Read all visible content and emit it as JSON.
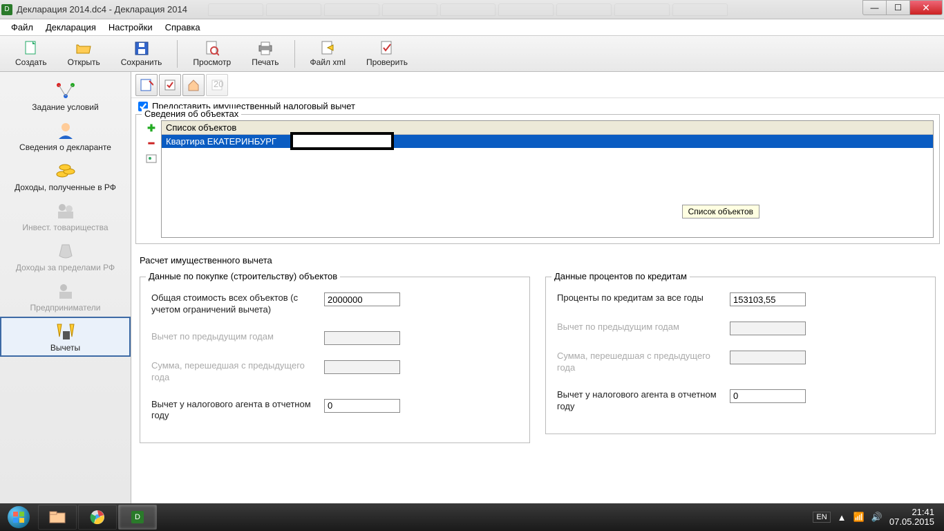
{
  "window": {
    "title": "Декларация 2014.dc4 - Декларация 2014"
  },
  "menu": {
    "file": "Файл",
    "declaration": "Декларация",
    "settings": "Настройки",
    "help": "Справка"
  },
  "toolbar": {
    "create": "Создать",
    "open": "Открыть",
    "save": "Сохранить",
    "preview": "Просмотр",
    "print": "Печать",
    "filexml": "Файл xml",
    "check": "Проверить"
  },
  "sidebar": {
    "conditions": "Задание условий",
    "declarant": "Сведения о декларанте",
    "income_rf": "Доходы, полученные в РФ",
    "invest": "Инвест. товарищества",
    "income_foreign": "Доходы за пределами РФ",
    "entrepreneurs": "Предприниматели",
    "deductions": "Вычеты"
  },
  "content": {
    "checkbox_label": "Предоставить имущественный налоговый вычет",
    "objects_group": "Сведения об объектах",
    "objects_header": "Список объектов",
    "object_row": "Квартира ЕКАТЕРИНБУРГ",
    "tooltip": "Список объектов",
    "calc_group": "Расчет имущественного вычета",
    "left_group": "Данные по покупке (строительству) объектов",
    "right_group": "Данные процентов по кредитам",
    "fields": {
      "total_cost_label": "Общая стоимость всех объектов (с учетом ограничений вычета)",
      "total_cost_value": "2000000",
      "prev_years_label": "Вычет по предыдущим годам",
      "prev_years_value": "",
      "carry_over_label": "Сумма, перешедшая с предыдущего года",
      "carry_over_value": "",
      "agent_label": "Вычет у налогового агента в отчетном году",
      "agent_value": "0",
      "interest_label": "Проценты по кредитам за все годы",
      "interest_value": "153103,55",
      "prev_years_r_label": "Вычет по предыдущим годам",
      "carry_over_r_label": "Сумма, перешедшая с предыдущего года",
      "agent_r_label": "Вычет у налогового агента в отчетном году",
      "agent_r_value": "0"
    }
  },
  "taskbar": {
    "lang": "EN",
    "time": "21:41",
    "date": "07.05.2015"
  }
}
